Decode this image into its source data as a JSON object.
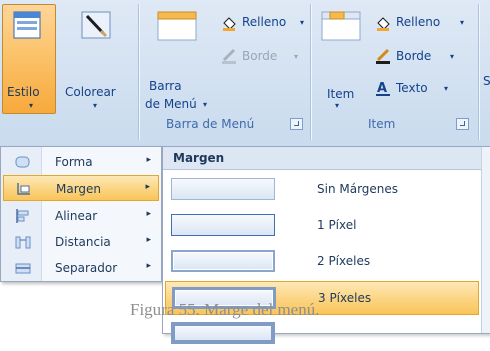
{
  "ribbon": {
    "estilo": {
      "label": "Estilo",
      "arrow": "▾"
    },
    "colorear": {
      "label": "Colorear",
      "arrow": "▾"
    },
    "barra_menu_group": {
      "button_line1": "Barra",
      "button_line2": "de Menú",
      "arrow": "▾",
      "relleno": "Relleno",
      "borde": "Borde",
      "title": "Barra de Menú"
    },
    "item_group": {
      "item": "Item",
      "arrow": "▾",
      "relleno": "Relleno",
      "borde": "Borde",
      "texto": "Texto",
      "title": "Item"
    },
    "cut_label": "S",
    "dropdown_arrow": "▾"
  },
  "style_menu": {
    "items": [
      {
        "label": "Forma",
        "icon": "shape-icon",
        "submenu": "▸"
      },
      {
        "label": "Margen",
        "icon": "margin-icon",
        "submenu": "▸",
        "highlighted": true
      },
      {
        "label": "Alinear",
        "icon": "align-icon",
        "submenu": "▸"
      },
      {
        "label": "Distancia",
        "icon": "distance-icon",
        "submenu": "▸"
      },
      {
        "label": "Separador",
        "icon": "separator-icon",
        "submenu": "▸"
      }
    ]
  },
  "margin_panel": {
    "title": "Margen",
    "options": [
      {
        "label": "Sin Márgenes",
        "border": 0
      },
      {
        "label": "1 Píxel",
        "border": 1
      },
      {
        "label": "2 Píxeles",
        "border": 2
      },
      {
        "label": "3 Píxeles",
        "border": 3,
        "highlighted": true
      }
    ]
  },
  "caption": "Figura 55. Marge del menú.",
  "colors": {
    "accent_orange": "#f9c55a",
    "ribbon_text": "#15428b",
    "ribbon_bg": "#d3e1f1"
  }
}
